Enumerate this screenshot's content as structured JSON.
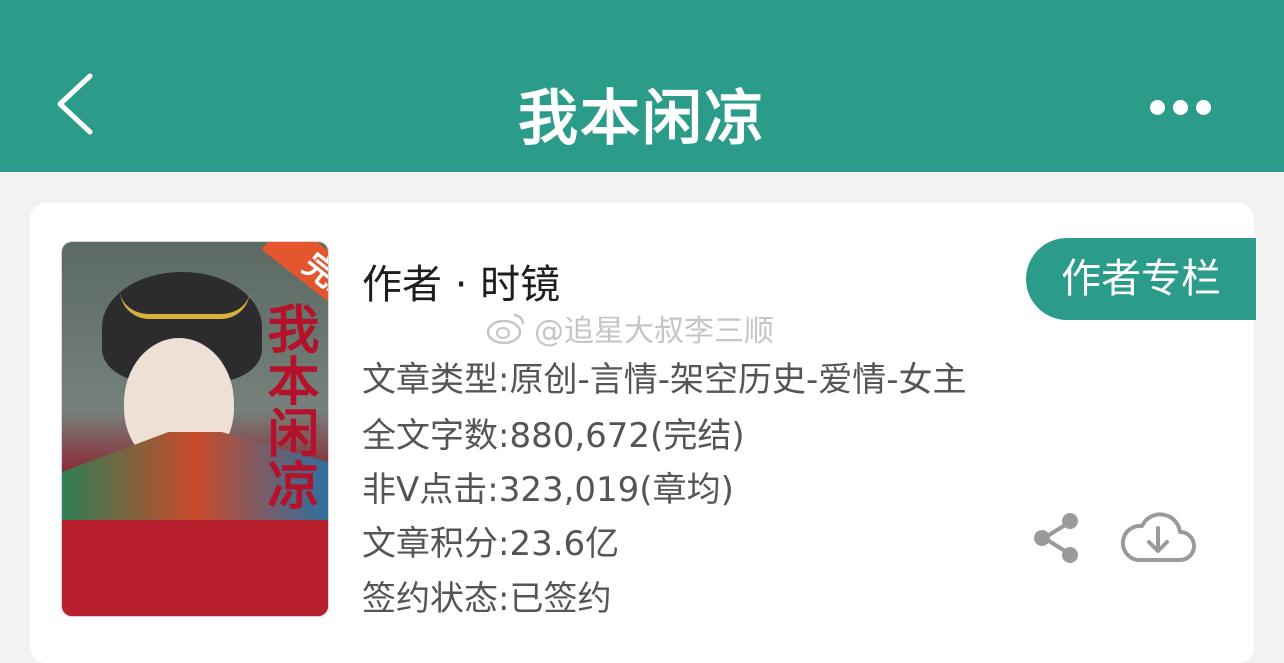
{
  "header": {
    "title": "我本闲凉",
    "back_icon": "chevron-left-icon",
    "more_icon": "more-horizontal-icon",
    "bg_color": "#2b9c89"
  },
  "book": {
    "cover_icon": "book-cover-image",
    "author": "作者 · 时镜",
    "author_column_button": "作者专栏",
    "info": [
      "文章类型:原创-言情-架空历史-爱情-女主",
      "全文字数:880,672(完结)",
      "非Ⅴ点击:323,019(章均)",
      "文章积分:23.6亿",
      "签约状态:已签约"
    ],
    "share_icon": "share-icon",
    "download_icon": "cloud-download-icon"
  },
  "watermark": {
    "text": "@追星大叔李三顺",
    "icon": "weibo-icon"
  }
}
